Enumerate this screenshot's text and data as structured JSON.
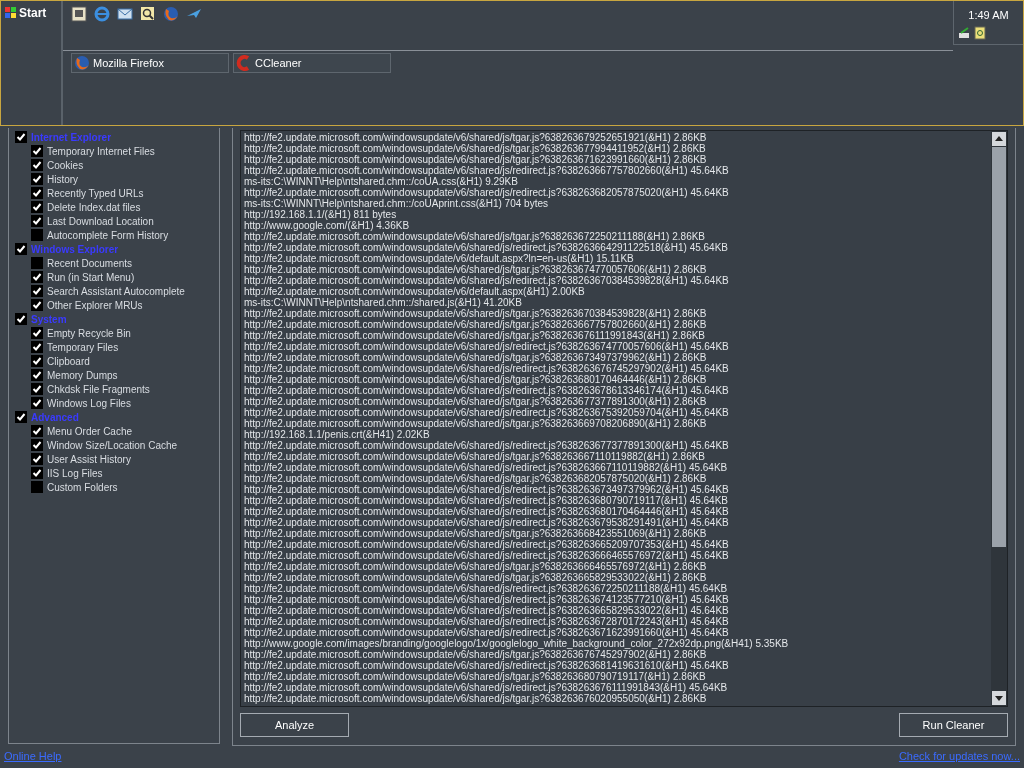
{
  "taskbar": {
    "start_label": "Start",
    "tasks": [
      {
        "label": "Mozilla Firefox",
        "kind": "browser"
      },
      {
        "label": "CCleaner",
        "kind": "cleaner"
      }
    ],
    "clock": "1:49 AM"
  },
  "categories": [
    {
      "label": "Internet Explorer",
      "checked": true,
      "children": [
        {
          "label": "Temporary Internet Files",
          "checked": true
        },
        {
          "label": "Cookies",
          "checked": true
        },
        {
          "label": "History",
          "checked": true
        },
        {
          "label": "Recently Typed URLs",
          "checked": true
        },
        {
          "label": "Delete Index.dat files",
          "checked": true
        },
        {
          "label": "Last Download Location",
          "checked": true
        },
        {
          "label": "Autocomplete Form History",
          "checked": false
        }
      ]
    },
    {
      "label": "Windows Explorer",
      "checked": true,
      "children": [
        {
          "label": "Recent Documents",
          "checked": false
        },
        {
          "label": "Run (in Start Menu)",
          "checked": true
        },
        {
          "label": "Search Assistant Autocomplete",
          "checked": true
        },
        {
          "label": "Other Explorer MRUs",
          "checked": true
        }
      ]
    },
    {
      "label": "System",
      "checked": true,
      "children": [
        {
          "label": "Empty Recycle Bin",
          "checked": true
        },
        {
          "label": "Temporary Files",
          "checked": true
        },
        {
          "label": "Clipboard",
          "checked": true
        },
        {
          "label": "Memory Dumps",
          "checked": true
        },
        {
          "label": "Chkdsk File Fragments",
          "checked": true
        },
        {
          "label": "Windows Log Files",
          "checked": true
        }
      ]
    },
    {
      "label": "Advanced",
      "checked": true,
      "children": [
        {
          "label": "Menu Order Cache",
          "checked": true
        },
        {
          "label": "Window Size/Location Cache",
          "checked": true
        },
        {
          "label": "User Assist History",
          "checked": true
        },
        {
          "label": "IIS Log Files",
          "checked": true
        },
        {
          "label": "Custom Folders",
          "checked": false
        }
      ]
    }
  ],
  "log_lines": [
    "http://fe2.update.microsoft.com/windowsupdate/v6/shared/js/tgar.js?638263679252651921(&H1) 2.86KB",
    "http://fe2.update.microsoft.com/windowsupdate/v6/shared/js/tgar.js?638263677994411952(&H1) 2.86KB",
    "http://fe2.update.microsoft.com/windowsupdate/v6/shared/js/tgar.js?638263671623991660(&H1) 2.86KB",
    "http://fe2.update.microsoft.com/windowsupdate/v6/shared/js/redirect.js?638263667757802660(&H1) 45.64KB",
    "ms-its:C:\\WINNT\\Help\\ntshared.chm::/coUA.css(&H1) 9.29KB",
    "http://fe2.update.microsoft.com/windowsupdate/v6/shared/js/redirect.js?638263682057875020(&H1) 45.64KB",
    "ms-its:C:\\WINNT\\Help\\ntshared.chm::/coUAprint.css(&H1) 704 bytes",
    "http://192.168.1.1/(&H1) 811 bytes",
    "http://www.google.com/(&H1) 4.36KB",
    "http://fe2.update.microsoft.com/windowsupdate/v6/shared/js/tgar.js?638263672250211188(&H1) 2.86KB",
    "http://fe2.update.microsoft.com/windowsupdate/v6/shared/js/redirect.js?638263664291122518(&H1) 45.64KB",
    "http://fe2.update.microsoft.com/windowsupdate/v6/default.aspx?ln=en-us(&H1) 15.11KB",
    "http://fe2.update.microsoft.com/windowsupdate/v6/shared/js/tgar.js?638263674770057606(&H1) 2.86KB",
    "http://fe2.update.microsoft.com/windowsupdate/v6/shared/js/redirect.js?638263670384539828(&H1) 45.64KB",
    "http://fe2.update.microsoft.com/windowsupdate/v6/default.aspx(&H1) 2.00KB",
    "ms-its:C:\\WINNT\\Help\\ntshared.chm::/shared.js(&H1) 41.20KB",
    "http://fe2.update.microsoft.com/windowsupdate/v6/shared/js/tgar.js?638263670384539828(&H1) 2.86KB",
    "http://fe2.update.microsoft.com/windowsupdate/v6/shared/js/tgar.js?638263667757802660(&H1) 2.86KB",
    "http://fe2.update.microsoft.com/windowsupdate/v6/shared/js/tgar.js?638263676111991843(&H1) 2.86KB",
    "http://fe2.update.microsoft.com/windowsupdate/v6/shared/js/redirect.js?638263674770057606(&H1) 45.64KB",
    "http://fe2.update.microsoft.com/windowsupdate/v6/shared/js/tgar.js?638263673497379962(&H1) 2.86KB",
    "http://fe2.update.microsoft.com/windowsupdate/v6/shared/js/redirect.js?638263676745297902(&H1) 45.64KB",
    "http://fe2.update.microsoft.com/windowsupdate/v6/shared/js/tgar.js?638263680170464446(&H1) 2.86KB",
    "http://fe2.update.microsoft.com/windowsupdate/v6/shared/js/redirect.js?638263678613346174(&H1) 45.64KB",
    "http://fe2.update.microsoft.com/windowsupdate/v6/shared/js/tgar.js?638263677377891300(&H1) 2.86KB",
    "http://fe2.update.microsoft.com/windowsupdate/v6/shared/js/redirect.js?638263675392059704(&H1) 45.64KB",
    "http://fe2.update.microsoft.com/windowsupdate/v6/shared/js/tgar.js?638263669708206890(&H1) 2.86KB",
    "http://192.168.1.1/penis.crt(&H41) 2.02KB",
    "http://fe2.update.microsoft.com/windowsupdate/v6/shared/js/redirect.js?638263677377891300(&H1) 45.64KB",
    "http://fe2.update.microsoft.com/windowsupdate/v6/shared/js/tgar.js?638263667110119882(&H1) 2.86KB",
    "http://fe2.update.microsoft.com/windowsupdate/v6/shared/js/redirect.js?638263667110119882(&H1) 45.64KB",
    "http://fe2.update.microsoft.com/windowsupdate/v6/shared/js/tgar.js?638263682057875020(&H1) 2.86KB",
    "http://fe2.update.microsoft.com/windowsupdate/v6/shared/js/redirect.js?638263673497379962(&H1) 45.64KB",
    "http://fe2.update.microsoft.com/windowsupdate/v6/shared/js/redirect.js?638263680790719117(&H1) 45.64KB",
    "http://fe2.update.microsoft.com/windowsupdate/v6/shared/js/redirect.js?638263680170464446(&H1) 45.64KB",
    "http://fe2.update.microsoft.com/windowsupdate/v6/shared/js/redirect.js?638263679538291491(&H1) 45.64KB",
    "http://fe2.update.microsoft.com/windowsupdate/v6/shared/js/tgar.js?638263668423551069(&H1) 2.86KB",
    "http://fe2.update.microsoft.com/windowsupdate/v6/shared/js/redirect.js?638263665209707353(&H1) 45.64KB",
    "http://fe2.update.microsoft.com/windowsupdate/v6/shared/js/redirect.js?638263666465576972(&H1) 45.64KB",
    "http://fe2.update.microsoft.com/windowsupdate/v6/shared/js/tgar.js?638263666465576972(&H1) 2.86KB",
    "http://fe2.update.microsoft.com/windowsupdate/v6/shared/js/tgar.js?638263665829533022(&H1) 2.86KB",
    "http://fe2.update.microsoft.com/windowsupdate/v6/shared/js/redirect.js?638263672250211188(&H1) 45.64KB",
    "http://fe2.update.microsoft.com/windowsupdate/v6/shared/js/redirect.js?638263674123577210(&H1) 45.64KB",
    "http://fe2.update.microsoft.com/windowsupdate/v6/shared/js/redirect.js?638263665829533022(&H1) 45.64KB",
    "http://fe2.update.microsoft.com/windowsupdate/v6/shared/js/redirect.js?638263672870172243(&H1) 45.64KB",
    "http://fe2.update.microsoft.com/windowsupdate/v6/shared/js/redirect.js?638263671623991660(&H1) 45.64KB",
    "http://www.google.com/images/branding/googlelogo/1x/googlelogo_white_background_color_272x92dp.png(&H41) 5.35KB",
    "http://fe2.update.microsoft.com/windowsupdate/v6/shared/js/tgar.js?638263676745297902(&H1) 2.86KB",
    "http://fe2.update.microsoft.com/windowsupdate/v6/shared/js/redirect.js?638263681419631610(&H1) 45.64KB",
    "http://fe2.update.microsoft.com/windowsupdate/v6/shared/js/tgar.js?638263680790719117(&H1) 2.86KB",
    "http://fe2.update.microsoft.com/windowsupdate/v6/shared/js/redirect.js?638263676111991843(&H1) 45.64KB",
    "http://fe2.update.microsoft.com/windowsupdate/v6/shared/js/tgar.js?638263676020955050(&H1) 2.86KB"
  ],
  "buttons": {
    "analyze": "Analyze",
    "run": "Run Cleaner"
  },
  "links": {
    "help": "Online Help",
    "updates": "Check for updates now..."
  }
}
